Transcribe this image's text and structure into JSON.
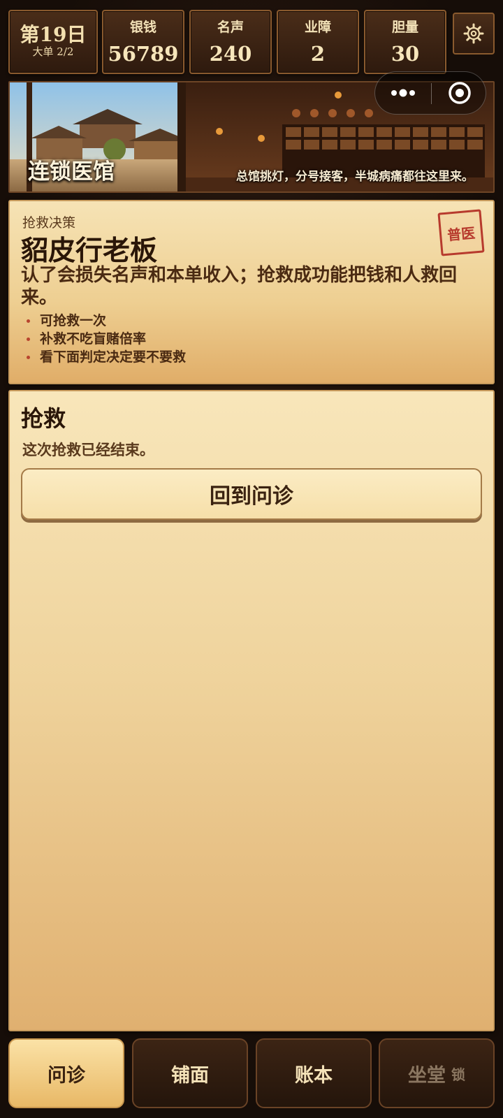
{
  "stats": {
    "day": "第19日",
    "order": "大单 2/2",
    "silver_label": "银钱",
    "silver_value": "56789",
    "fame_label": "名声",
    "fame_value": "240",
    "karma_label": "业障",
    "karma_value": "2",
    "courage_label": "胆量",
    "courage_value": "30",
    "settings_icon": "gear-icon"
  },
  "banner": {
    "title": "连锁医馆",
    "subtitle": "总馆挑灯，分号接客，半城病痛都往这里来。",
    "more_icon": "more-dots-icon",
    "close_icon": "target-close-icon"
  },
  "decision": {
    "label": "抢救决策",
    "title": "貂皮行老板",
    "description": "认了会损失名声和本单收入；抢救成功能把钱和人救回来。",
    "points": [
      "可抢救一次",
      "补救不吃盲赌倍率",
      "看下面判定决定要不要救"
    ],
    "stamp": "普医"
  },
  "rescue": {
    "title": "抢救",
    "status": "这次抢救已经结束。",
    "button_label": "回到问诊"
  },
  "nav": {
    "items": [
      {
        "label": "问诊",
        "active": true
      },
      {
        "label": "铺面",
        "active": false
      },
      {
        "label": "账本",
        "active": false
      },
      {
        "label": "坐堂",
        "active": false,
        "tag": "锁"
      }
    ]
  },
  "colors": {
    "background": "#1e120b",
    "parchment": "#f6e3b5",
    "stamp_red": "#b73a2d",
    "nav_active": "#fbe2a6"
  }
}
